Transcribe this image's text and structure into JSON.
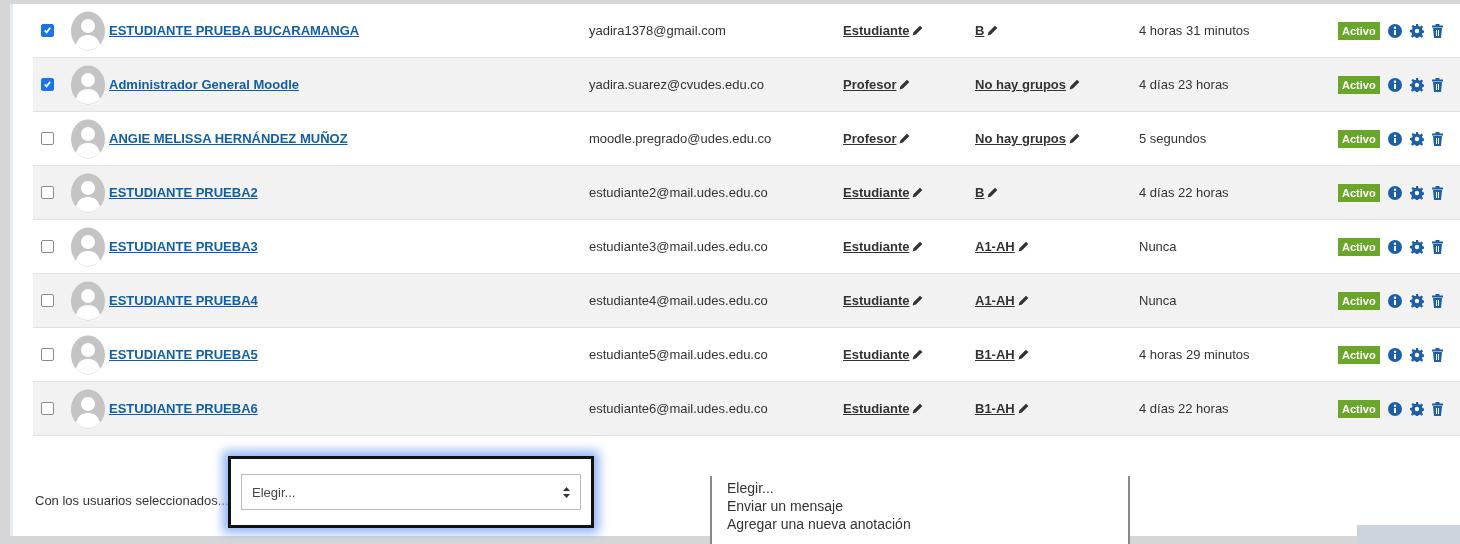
{
  "users": [
    {
      "selected": true,
      "name": "ESTUDIANTE PRUEBA BUCARAMANGA",
      "email": "yadira1378@gmail.com",
      "role": "Estudiante",
      "group": "B",
      "last_access": "4 horas 31 minutos",
      "status": "Activo"
    },
    {
      "selected": true,
      "name": "Administrador General Moodle",
      "email": "yadira.suarez@cvudes.edu.co",
      "role": "Profesor",
      "group": "No hay grupos",
      "last_access": "4 días 23 horas",
      "status": "Activo"
    },
    {
      "selected": false,
      "name": "ANGIE MELISSA HERNÁNDEZ MUÑOZ",
      "email": "moodle.pregrado@udes.edu.co",
      "role": "Profesor",
      "group": "No hay grupos",
      "last_access": "5 segundos",
      "status": "Activo"
    },
    {
      "selected": false,
      "name": "ESTUDIANTE PRUEBA2",
      "email": "estudiante2@mail.udes.edu.co",
      "role": "Estudiante",
      "group": "B",
      "last_access": "4 días 22 horas",
      "status": "Activo"
    },
    {
      "selected": false,
      "name": "ESTUDIANTE PRUEBA3",
      "email": "estudiante3@mail.udes.edu.co",
      "role": "Estudiante",
      "group": "A1-AH",
      "last_access": "Nunca",
      "status": "Activo"
    },
    {
      "selected": false,
      "name": "ESTUDIANTE PRUEBA4",
      "email": "estudiante4@mail.udes.edu.co",
      "role": "Estudiante",
      "group": "A1-AH",
      "last_access": "Nunca",
      "status": "Activo"
    },
    {
      "selected": false,
      "name": "ESTUDIANTE PRUEBA5",
      "email": "estudiante5@mail.udes.edu.co",
      "role": "Estudiante",
      "group": "B1-AH",
      "last_access": "4 horas 29 minutos",
      "status": "Activo"
    },
    {
      "selected": false,
      "name": "ESTUDIANTE PRUEBA6",
      "email": "estudiante6@mail.udes.edu.co",
      "role": "Estudiante",
      "group": "B1-AH",
      "last_access": "4 días 22 horas",
      "status": "Activo"
    }
  ],
  "bulk_action": {
    "label": "Con los usuarios seleccionados...",
    "select": {
      "value": "Elegir...",
      "focused": true
    },
    "options": [
      "Elegir...",
      "Enviar un mensaje",
      "Agregar una nueva anotación"
    ]
  }
}
